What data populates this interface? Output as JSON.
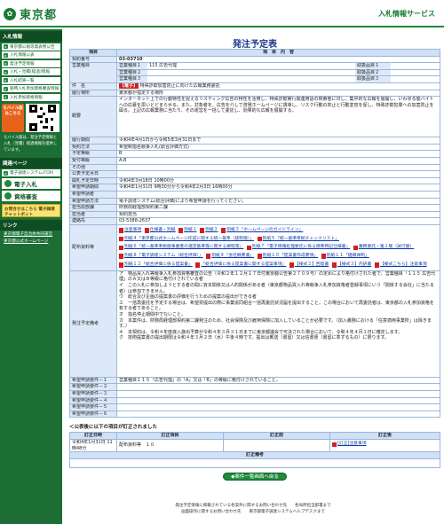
{
  "header": {
    "logo_mark": "✿",
    "logo_text": "東京都",
    "service_title": "入札情報サービス"
  },
  "sidebar": {
    "menu_title": "入札情報",
    "menu_items": [
      {
        "label": "東京都公報等発表物公告",
        "icon": "list-icon"
      },
      {
        "label": "入札情報公表",
        "icon": "list-icon"
      },
      {
        "label": "発注予定情報",
        "icon": "list-icon"
      },
      {
        "label": "入札・見積(経過)情報",
        "icon": "list-icon"
      },
      {
        "label": "入札結果一覧",
        "icon": "list-icon"
      },
      {
        "label": "随時入札参加資格審査情報",
        "icon": "list-icon"
      },
      {
        "label": "入札参加資格情報",
        "icon": "list-icon"
      }
    ],
    "mobile_label": "モバイル版はこちら",
    "mobile_note": "モバイル版は、発注予定情報と入札（見積）経過情報を提供しています。",
    "help_title": "関連ページ",
    "help_items": [
      {
        "label": "電子調達システム(TOP)",
        "icon": "home-icon"
      },
      {
        "label": "電子入札",
        "icon": "pc-icon"
      },
      {
        "label": "資格審査",
        "icon": "doc-icon"
      }
    ],
    "app_label": "お問合せはこちら 電子調達チャットボット",
    "links_title": "リンク",
    "links": [
      "東京都電子自治体共同運営",
      "東京都公式ホームページ"
    ]
  },
  "page_title": "発注予定表",
  "table": {
    "col_item": "項目",
    "col_content": "項　目　内　容",
    "rows": {
      "contract_no": {
        "label": "契約番号",
        "value": "03-03710"
      },
      "dept": {
        "label": "営業種目",
        "lines": [
          {
            "name": "営業種目１",
            "code": "115 広告代理",
            "rank_label": "取扱品目１",
            "rank_value": ""
          },
          {
            "name": "営業種目２",
            "code": "",
            "rank_label": "取扱品目２",
            "rank_value": ""
          },
          {
            "name": "営業種目３",
            "code": "",
            "rank_label": "取扱品目３",
            "rank_value": ""
          }
        ]
      },
      "subject": {
        "label": "件　名",
        "tag": "【電子】",
        "value": "特殊詐欺加害防止に向けた広報業務委託"
      },
      "place": {
        "label": "履行場所",
        "value": "東京都が指定する場所"
      },
      "summary": {
        "label": "概要",
        "value": "インターネット上での行動特性を捉えるリスティング広告の特性を活用し、特殊詐欺実行関連用語の検索者に対し、集中的な広報を展開し、いわゆる闇バイトへの応募を思いとどまらせる。また、対象者を、広告を介して啓発ホームページに誘導し、リスク行動の抑止と行動変容を促し、特殊詐欺犯罪への加害防止を図る。上記の広報業務に当たり、その運営を一括して委託し、効果的な広報を展開する。"
      },
      "period": {
        "label": "履行期間",
        "value": "令和4年4月1日から令和5年3月31日まで"
      },
      "method": {
        "label": "契約方法",
        "value": "希望制指名競争入札(総合評価方式)"
      },
      "grade": {
        "label": "予定等級",
        "value": "B"
      },
      "grade2": {
        "label": "受付等級",
        "value": "A,B"
      },
      "other": {
        "label": "その他",
        "value": ""
      },
      "announce": {
        "label": "公表予定月日",
        "value": ""
      },
      "open": {
        "label": "開札予定日時",
        "value": "令和4年3月18日 10時00分"
      },
      "apply": {
        "label": "希望申請期間",
        "value": "令和4年1月31日 9時30分から令和4年2月3日 16時00分"
      },
      "applicant": {
        "label": "希望申請者",
        "value": ""
      },
      "apply_method": {
        "label": "希望申請方法",
        "value": "電子調達システム(総合評価)により希望申請を行ってください。"
      },
      "section": {
        "label": "担当局部課",
        "value": "財務局経理部契約第二課"
      },
      "person": {
        "label": "担当者",
        "value": "契約担当"
      },
      "contact": {
        "label": "連絡先",
        "value": "03-5388-2637"
      },
      "docs": {
        "label": "配布資料等",
        "items": [
          "注意事項",
          "仕様書・別紙",
          "別紙１",
          "別紙２",
          "別紙３「ホームページのガイドライン」",
          "別紙４「東京都公式ホームページ作成に関する統一基準（抜粋版）」",
          "別紙５「統一基準準拠チェックリスト」",
          "別紙６「統一基準準拠版事業者の選定基準等に関する規程等」",
          "別紙７「電子情報処理委託に係る標準特記仕様書」",
          "業務委託・第１版（試行版）",
          "別紙８「電子調達システム（総合評価）」",
          "別紙９「会社概要書」",
          "別紙１０「提案書作成要領」",
          "別紙１１「組織体制」",
          "別紙１２「総合評価に係る提案書」",
          "「総合評価に係る提案書に関する提案事項」",
          "【様式２】回答書",
          "【様式３】内訳書",
          "【様式こちら】注意事項"
        ]
      },
      "notes": {
        "label": "発注予定備考",
        "value": "ア　物品買入れ等競争入札参加資格審査の公告（令和２年１２月１７日付東京都公告第２７０９号）の定めにより格付けされた者で、営業種目「１１５ 広告代理」のＡ又はＢ等級に格付けされている者\nイ　この入札に参加しようとする者の間に資本関係又は人的関係がある者（東京都物品買入れ等競争入札参加資格者登録事項にいう「関係する会社」に当たる者）は参加できません。\nウ　総合及び企画の提案書の評価を行うための提案の提出ができる者\nエ　一括再委託を予定する場合は、希望票提出の際に事業協同組合一括再委託状況届を提出すること。この場合において再委託者は、東京都の入札参加資格を有する者であること。\nオ　指名停止期間中でないこと。\nカ　本案件は、財務局経理部契約第二課発注のため、社会保険及び雇用保険に加入していることが必要です。（加入義務における「任意適用事業所」は除きます。）\nキ　本契約は、令和４年度歳入歳出予算が令和４年３月３１日までに東京都議会で可決された場合において、令和４年４月１日に確定します。\nク　技術提案書の提出期限は令和４年３月２日（水）午後４時です。提出は郵送（書留）又は信書便（書留に準ずるもの）に限ります。"
      },
      "req1": {
        "label": "希望申請要件－１",
        "value": "営業種目１１５「広告代理」の「A」又は「B」の等級に格付けされていること。"
      },
      "req2": {
        "label": "希望申請要件－２",
        "value": ""
      },
      "req3": {
        "label": "希望申請要件－３",
        "value": ""
      },
      "req4": {
        "label": "希望申請要件－４",
        "value": ""
      },
      "req5": {
        "label": "希望申請要件－５",
        "value": ""
      },
      "req6": {
        "label": "希望申請要件－６",
        "value": ""
      }
    }
  },
  "amend": {
    "title": "＜公表後に以下の項目が訂正されました",
    "headers": [
      "訂正日時",
      "訂正項目",
      "訂正前",
      "訂正後"
    ],
    "row": {
      "date": "令和4年1月31日 11時48分",
      "item": "配布資料等　１０",
      "before": "",
      "after": "[訂正]注意事項"
    },
    "remark_header": "訂正備考",
    "remark": ""
  },
  "back_button": "◆案件一覧画面へ戻る",
  "footer": {
    "line1": "発注予定情報に掲載されている各案件に関するお問い合わせ先　　各局所担当部署まで",
    "line2": "画面操作に関するお問い合わせ先　　東京都電子調達システムヘルプデスクまで"
  }
}
